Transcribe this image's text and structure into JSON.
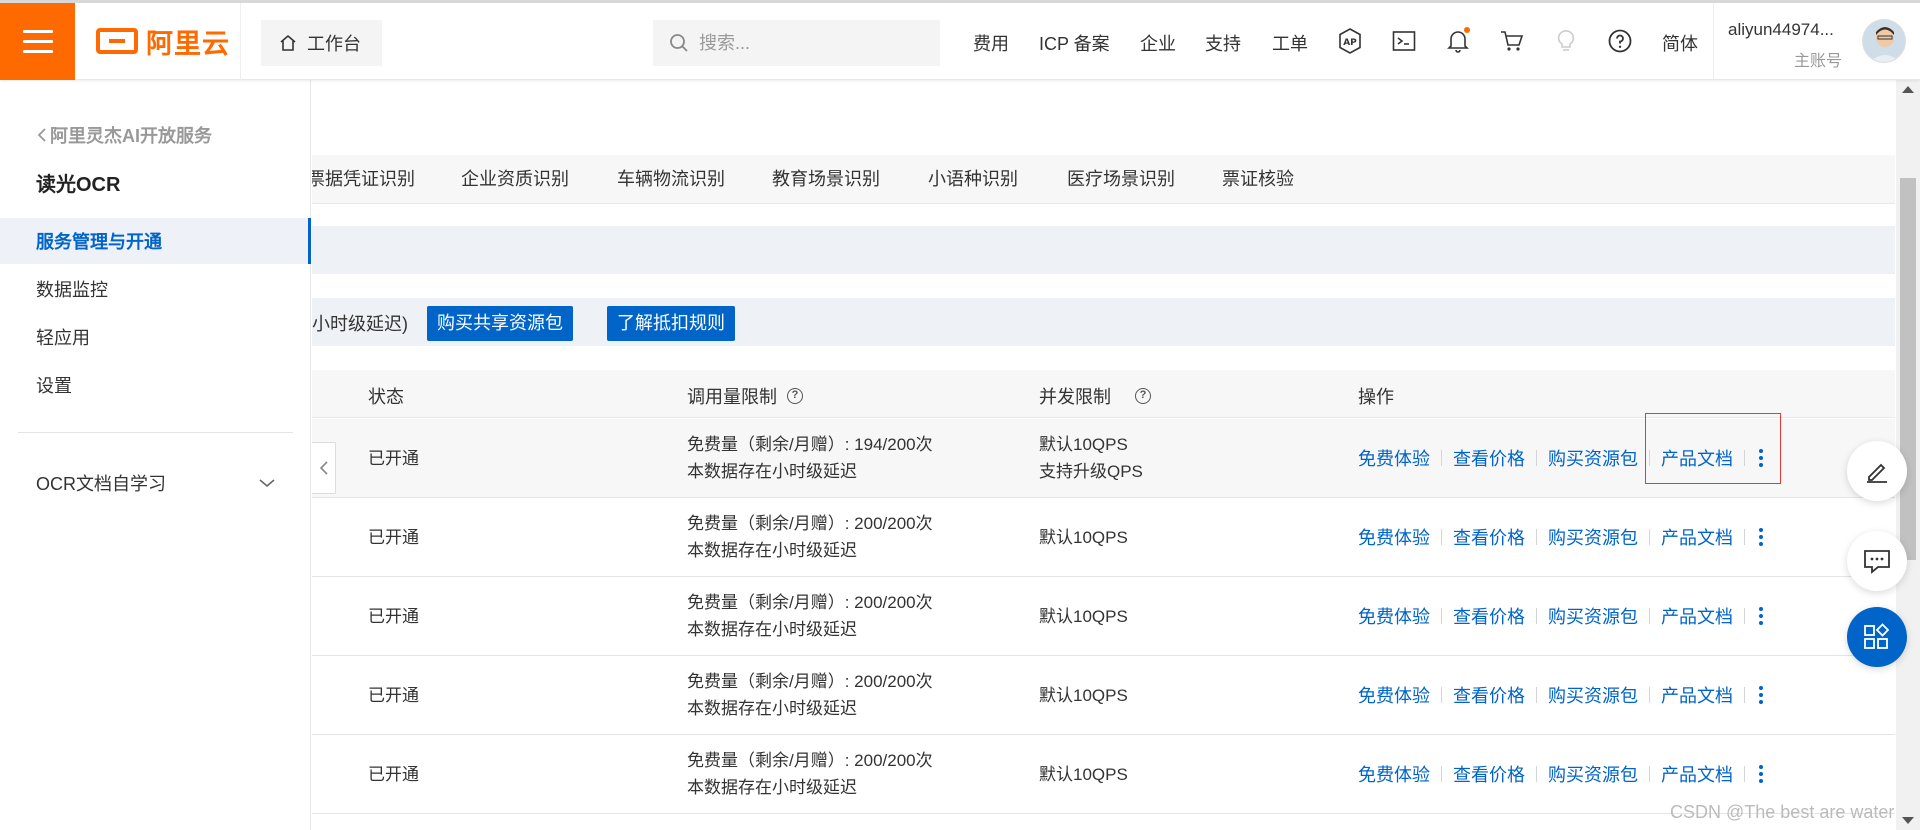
{
  "header": {
    "logo_text": "阿里云",
    "workbench_label": "工作台",
    "search_placeholder": "搜索...",
    "nav": [
      "费用",
      "ICP 备案",
      "企业",
      "支持",
      "工单"
    ],
    "lang_label": "简体",
    "user_name": "aliyun44974...",
    "user_role": "主账号",
    "icons": [
      "app-icon",
      "terminal-icon",
      "bell-icon",
      "cart-icon",
      "bulb-icon",
      "help-icon"
    ]
  },
  "sidebar": {
    "back_label": "阿里灵杰AI开放服务",
    "product_title": "读光OCR",
    "items": [
      {
        "label": "服务管理与开通",
        "active": true
      },
      {
        "label": "数据监控",
        "active": false
      },
      {
        "label": "轻应用",
        "active": false
      },
      {
        "label": "设置",
        "active": false
      }
    ],
    "group_label": "OCR文档自学习"
  },
  "main": {
    "tabs": [
      "票据凭证识别",
      "企业资质识别",
      "车辆物流识别",
      "教育场景识别",
      "小语种识别",
      "医疗场景识别",
      "票证核验"
    ],
    "info_text": "小时级延迟)",
    "buy_shared_btn": "购买共享资源包",
    "deduct_rules_btn": "了解抵扣规则",
    "table": {
      "headers": {
        "status": "状态",
        "quota": "调用量限制",
        "concurrency": "并发限制",
        "actions": "操作"
      },
      "rows": [
        {
          "status": "已开通",
          "quota_line1": "免费量（剩余/月赠）: 194/200次",
          "quota_line2": "本数据存在小时级延迟",
          "conc_line1": "默认10QPS",
          "conc_line2": "支持升级QPS"
        },
        {
          "status": "已开通",
          "quota_line1": "免费量（剩余/月赠）: 200/200次",
          "quota_line2": "本数据存在小时级延迟",
          "conc_line1": "默认10QPS",
          "conc_line2": ""
        },
        {
          "status": "已开通",
          "quota_line1": "免费量（剩余/月赠）: 200/200次",
          "quota_line2": "本数据存在小时级延迟",
          "conc_line1": "默认10QPS",
          "conc_line2": ""
        },
        {
          "status": "已开通",
          "quota_line1": "免费量（剩余/月赠）: 200/200次",
          "quota_line2": "本数据存在小时级延迟",
          "conc_line1": "默认10QPS",
          "conc_line2": ""
        },
        {
          "status": "已开通",
          "quota_line1": "免费量（剩余/月赠）: 200/200次",
          "quota_line2": "本数据存在小时级延迟",
          "conc_line1": "默认10QPS",
          "conc_line2": ""
        }
      ],
      "action_labels": [
        "免费体验",
        "查看价格",
        "购买资源包",
        "产品文档"
      ]
    }
  },
  "watermark": "CSDN @The best are water",
  "colors": {
    "brand_orange": "#ff6a00",
    "link_blue": "#0064c8",
    "highlight_red": "#e53935"
  }
}
